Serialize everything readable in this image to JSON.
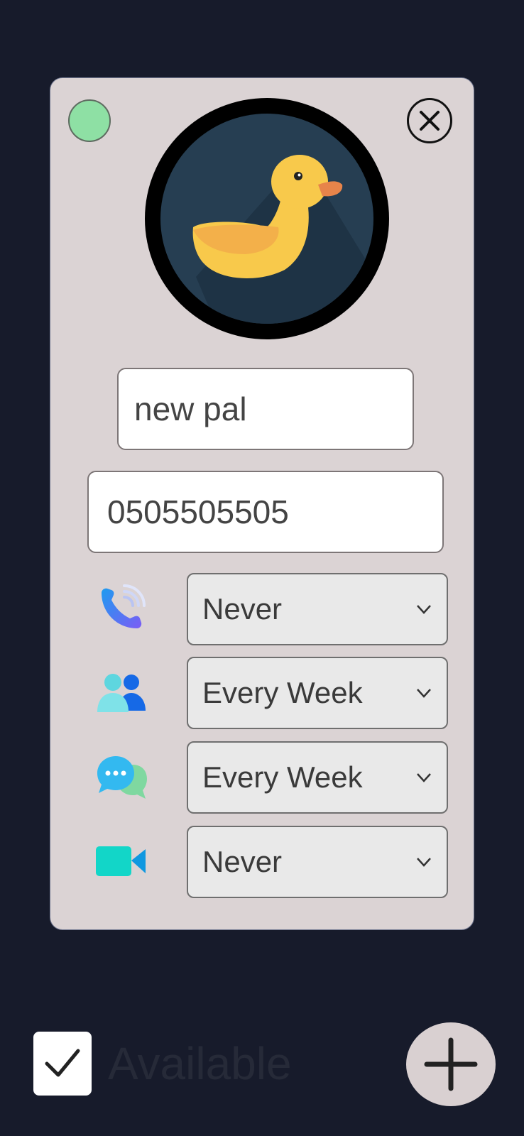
{
  "card": {
    "status": "online",
    "name_value": "new pal",
    "phone_value": "0505505505",
    "avatar_icon": "duck-avatar-icon"
  },
  "frequencies": [
    {
      "icon": "phone-call-icon",
      "value": "Never"
    },
    {
      "icon": "meet-people-icon",
      "value": "Every Week"
    },
    {
      "icon": "chat-bubbles-icon",
      "value": "Every Week"
    },
    {
      "icon": "video-camera-icon",
      "value": "Never"
    }
  ],
  "footer": {
    "available_label": "Available",
    "available_checked": true
  },
  "colors": {
    "background": "#171b2b",
    "card": "#dbd3d4",
    "status_online": "#8ee0a4"
  }
}
